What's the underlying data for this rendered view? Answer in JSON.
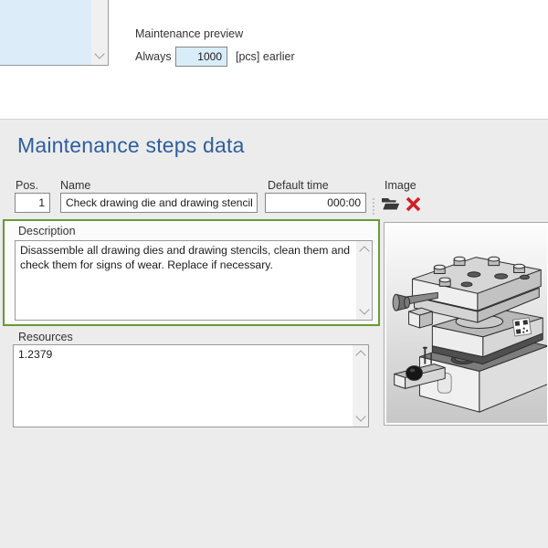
{
  "top": {
    "preview_label": "Maintenance preview",
    "always_label": "Always",
    "quantity_value": "1000",
    "unit_label": "[pcs] earlier"
  },
  "section": {
    "title": "Maintenance steps data"
  },
  "fields": {
    "pos": {
      "label": "Pos.",
      "value": "1"
    },
    "name": {
      "label": "Name",
      "value": "Check drawing die and drawing stencil"
    },
    "default_time": {
      "label": "Default time",
      "value": "000:00"
    },
    "image": {
      "label": "Image"
    },
    "description": {
      "label": "Description",
      "value": "Disassemble all drawing dies and drawing stencils, clean them and check them for signs of wear. Replace if necessary."
    },
    "resources": {
      "label": "Resources",
      "value": "1.2379"
    }
  },
  "icons": {
    "image_open": "open-folder-icon",
    "image_delete": "delete-x-icon",
    "scroll_up": "chevron-up-icon",
    "scroll_down": "chevron-down-icon",
    "drag_handle": "gripper-dots-icon"
  },
  "colors": {
    "accent_green": "#679a37",
    "heading_blue": "#2e5e9e",
    "highlight_blue_fill": "#d9ecf9",
    "delete_red": "#cf2127",
    "section_bg": "#ececec"
  }
}
